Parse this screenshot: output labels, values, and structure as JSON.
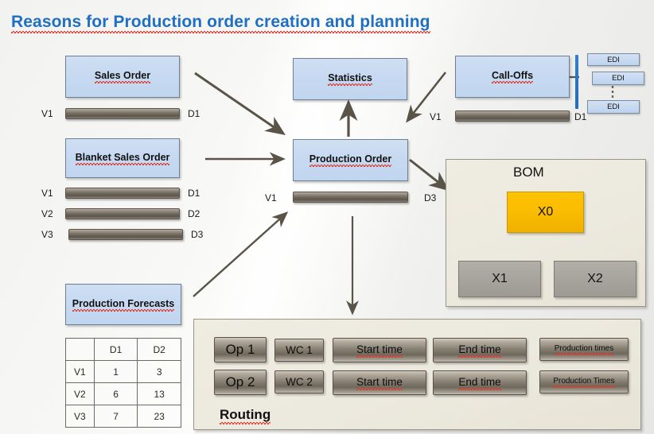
{
  "title": "Reasons  for Production order creation and planning",
  "boxes": {
    "sales_order": "Sales Order",
    "blanket_sales_order": "Blanket Sales Order",
    "statistics": "Statistics",
    "call_offs": "Call-Offs",
    "production_order": "Production Order",
    "production_forecasts": "Production Forecasts"
  },
  "edi": {
    "item1": "EDI",
    "item2": "EDI",
    "item3": "EDI"
  },
  "labels": {
    "sales_v1": "V1",
    "sales_d1": "D1",
    "blanket_v1": "V1",
    "blanket_v2": "V2",
    "blanket_v3": "V3",
    "blanket_d1": "D1",
    "blanket_d2": "D2",
    "blanket_d3": "D3",
    "po_v1": "V1",
    "po_d3": "D3",
    "calloff_v1": "V1",
    "calloff_d1": "D1"
  },
  "bom": {
    "title": "BOM",
    "parent": "X0",
    "child1": "X1",
    "child2": "X2"
  },
  "routing": {
    "title": "Routing",
    "rows": [
      {
        "op": "Op 1",
        "wc": "WC 1",
        "start": "Start  time",
        "end": "End time",
        "prod": "Production  times"
      },
      {
        "op": "Op 2",
        "wc": "WC 2",
        "start": "Start time",
        "end": "End time",
        "prod": "Production Times"
      }
    ]
  },
  "forecast_table": {
    "columns": [
      "",
      "D1",
      "D2"
    ],
    "rows": [
      {
        "label": "V1",
        "d1": "1",
        "d2": "3"
      },
      {
        "label": "V2",
        "d1": "6",
        "d2": "13"
      },
      {
        "label": "V3",
        "d1": "7",
        "d2": "23"
      }
    ]
  },
  "colors": {
    "title": "#1f6fc4",
    "box_fill": "#c6d9f1",
    "box_border": "#6f7f93",
    "bar": "#6e675c",
    "panel": "#ece9de",
    "orange": "#fbbd00",
    "gray": "#a7a49d",
    "arrow": "#5a5348",
    "blue_line": "#2f7fd4",
    "spell_underline": "#e03a2f"
  }
}
